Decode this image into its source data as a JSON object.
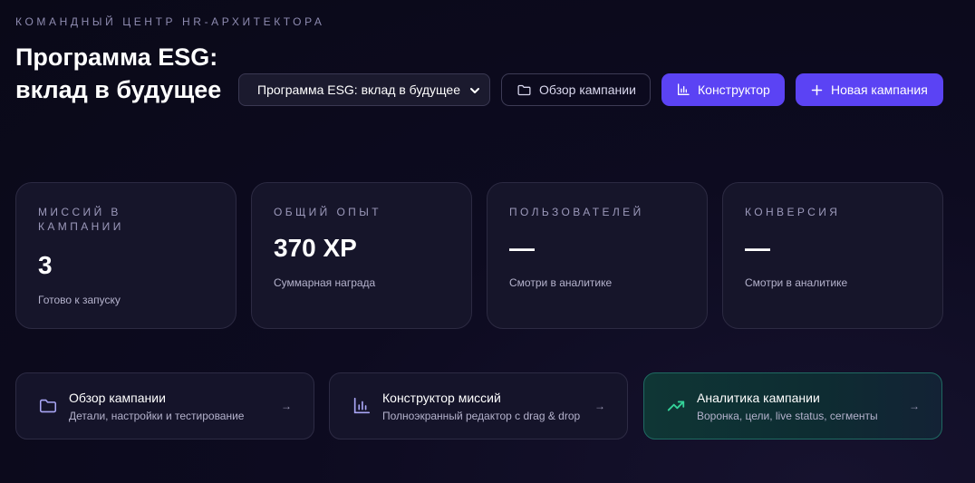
{
  "header": {
    "eyebrow": "КОМАНДНЫЙ ЦЕНТР HR-АРХИТЕКТОРА",
    "title": "Программа ESG: вклад в будущее"
  },
  "toolbar": {
    "campaign_select": "Программа ESG: вклад в будущее",
    "overview_button": "Обзор кампании",
    "constructor_button": "Конструктор",
    "new_campaign_button": "Новая кампания"
  },
  "stats": [
    {
      "label": "МИССИЙ В КАМПАНИИ",
      "value": "3",
      "hint": "Готово к запуску"
    },
    {
      "label": "ОБЩИЙ ОПЫТ",
      "value": "370 XP",
      "hint": "Суммарная награда"
    },
    {
      "label": "ПОЛЬЗОВАТЕЛЕЙ",
      "value": "—",
      "hint": "Смотри в аналитике"
    },
    {
      "label": "КОНВЕРСИЯ",
      "value": "—",
      "hint": "Смотри в аналитике"
    }
  ],
  "cards": [
    {
      "title": "Обзор кампании",
      "subtitle": "Детали, настройки и тестирование",
      "arrow": "→",
      "icon": "folder-icon"
    },
    {
      "title": "Конструктор миссий",
      "subtitle": "Полноэкранный редактор с drag & drop",
      "arrow": "→",
      "icon": "bar-chart-icon"
    },
    {
      "title": "Аналитика кампании",
      "subtitle": "Воронка, цели, live status, сегменты",
      "arrow": "→",
      "icon": "trending-up-icon"
    }
  ],
  "colors": {
    "accent": "#5b43f4",
    "background": "#0b0a1a",
    "card": "#16152a",
    "teal": "#34d399"
  }
}
